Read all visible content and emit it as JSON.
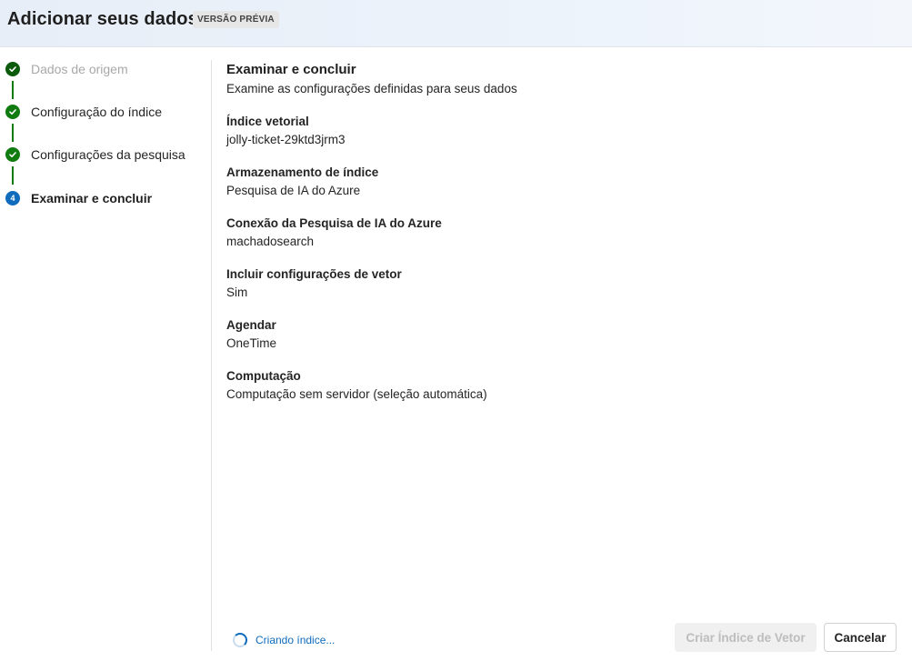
{
  "header": {
    "title": "Adicionar seus dados",
    "badge": "VERSÃO PRÉVIA",
    "background_color": "#e8eef7"
  },
  "steps": [
    {
      "label": "Dados de origem",
      "state": "completed",
      "icon": "checkmark-circle-icon"
    },
    {
      "label": "Configuração do índice",
      "state": "completed",
      "icon": "checkmark-circle-icon"
    },
    {
      "label": "Configurações da pesquisa",
      "state": "completed",
      "icon": "checkmark-circle-icon"
    },
    {
      "label": "Examinar e concluir",
      "state": "current",
      "number": "4"
    }
  ],
  "main": {
    "heading": "Examinar e concluir",
    "subtitle": "Examine as configurações definidas para seus dados",
    "fields": [
      {
        "label": "Índice vetorial",
        "value": "jolly-ticket-29ktd3jrm3"
      },
      {
        "label": "Armazenamento de índice",
        "value": "Pesquisa de IA do Azure"
      },
      {
        "label": "Conexão da Pesquisa de IA do Azure",
        "value": "machadosearch"
      },
      {
        "label": "Incluir configurações de vetor",
        "value": "Sim"
      },
      {
        "label": "Agendar",
        "value": "OneTime"
      },
      {
        "label": "Computação",
        "value": "Computação sem servidor (seleção automática)"
      }
    ]
  },
  "footer": {
    "status_text": "Criando índice...",
    "primary_button": "Criar Índice de Vetor",
    "primary_disabled": true,
    "cancel_button": "Cancelar"
  },
  "colors": {
    "success": "#107c10",
    "accent": "#0f6cbd"
  }
}
